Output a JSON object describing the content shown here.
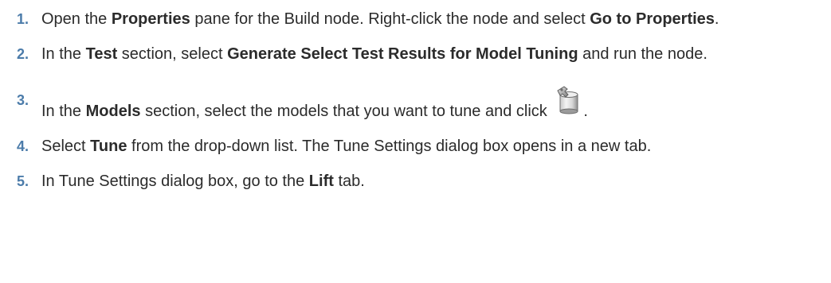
{
  "steps": [
    {
      "number": "1.",
      "t1": "Open the ",
      "b1": "Properties",
      "t2": " pane for the Build node. Right-click the node and select ",
      "b2": "Go to Properties",
      "t3": "."
    },
    {
      "number": "2.",
      "t1": "In the ",
      "b1": "Test",
      "t2": " section, select ",
      "b2": "Generate Select Test Results for Model Tuning",
      "t3": " and run the node."
    },
    {
      "number": "3.",
      "t1": "In the ",
      "b1": "Models",
      "t2": " section, select the models that you want to tune and click ",
      "t3": ".",
      "icon": "tune-model-icon"
    },
    {
      "number": "4.",
      "t1": "Select ",
      "b1": "Tune",
      "t2": " from the drop-down list. The Tune Settings dialog box opens in a new tab."
    },
    {
      "number": "5.",
      "t1": "In Tune Settings dialog box, go to the ",
      "b1": "Lift",
      "t2": " tab."
    }
  ],
  "colors": {
    "step_number": "#4c7caa",
    "text": "#2b2b2b"
  }
}
